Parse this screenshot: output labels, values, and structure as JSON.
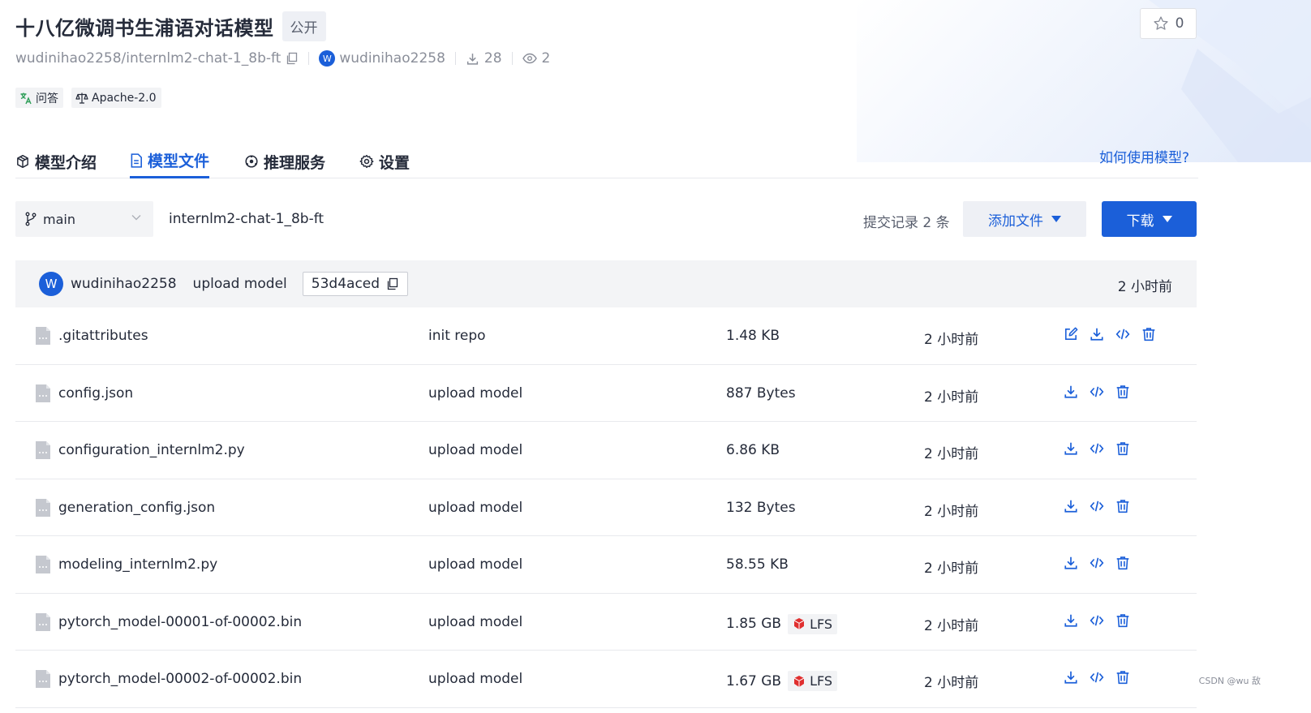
{
  "model": {
    "title": "十八亿微调书生浦语对话模型",
    "visibility": "公开",
    "star_count": "0",
    "repo_path": "wudinihao2258/internlm2-chat-1_8b-ft",
    "owner": "wudinihao2258",
    "owner_initial": "W",
    "downloads": "28",
    "views": "2",
    "tags": [
      "问答",
      "Apache-2.0"
    ]
  },
  "tabs": [
    {
      "label": "模型介绍",
      "icon": "cube-icon",
      "active": false
    },
    {
      "label": "模型文件",
      "icon": "file-icon",
      "active": true
    },
    {
      "label": "推理服务",
      "icon": "inference-icon",
      "active": false
    },
    {
      "label": "设置",
      "icon": "gear-icon",
      "active": false
    }
  ],
  "help_link": "如何使用模型?",
  "toolbar": {
    "branch": "main",
    "path": "internlm2-chat-1_8b-ft",
    "commits": "提交记录 2 条",
    "add_file": "添加文件",
    "download": "下载"
  },
  "latest_commit": {
    "author": "wudinihao2258",
    "author_initial": "W",
    "message": "upload model",
    "hash": "53d4aced",
    "time": "2 小时前"
  },
  "files": [
    {
      "name": ".gitattributes",
      "message": "init repo",
      "size": "1.48 KB",
      "lfs": false,
      "time": "2 小时前",
      "editable": true
    },
    {
      "name": "config.json",
      "message": "upload model",
      "size": "887 Bytes",
      "lfs": false,
      "time": "2 小时前",
      "editable": false
    },
    {
      "name": "configuration_internlm2.py",
      "message": "upload model",
      "size": "6.86 KB",
      "lfs": false,
      "time": "2 小时前",
      "editable": false
    },
    {
      "name": "generation_config.json",
      "message": "upload model",
      "size": "132 Bytes",
      "lfs": false,
      "time": "2 小时前",
      "editable": false
    },
    {
      "name": "modeling_internlm2.py",
      "message": "upload model",
      "size": "58.55 KB",
      "lfs": false,
      "time": "2 小时前",
      "editable": false
    },
    {
      "name": "pytorch_model-00001-of-00002.bin",
      "message": "upload model",
      "size": "1.85 GB",
      "lfs": true,
      "time": "2 小时前",
      "editable": false
    },
    {
      "name": "pytorch_model-00002-of-00002.bin",
      "message": "upload model",
      "size": "1.67 GB",
      "lfs": true,
      "time": "2 小时前",
      "editable": false
    }
  ],
  "lfs_label": "LFS",
  "watermark": "CSDN @wu 敌",
  "colors": {
    "accent": "#1b5fd9",
    "text": "#252b3a",
    "muted": "#8a8e99",
    "lfs_red": "#e02f2f"
  }
}
